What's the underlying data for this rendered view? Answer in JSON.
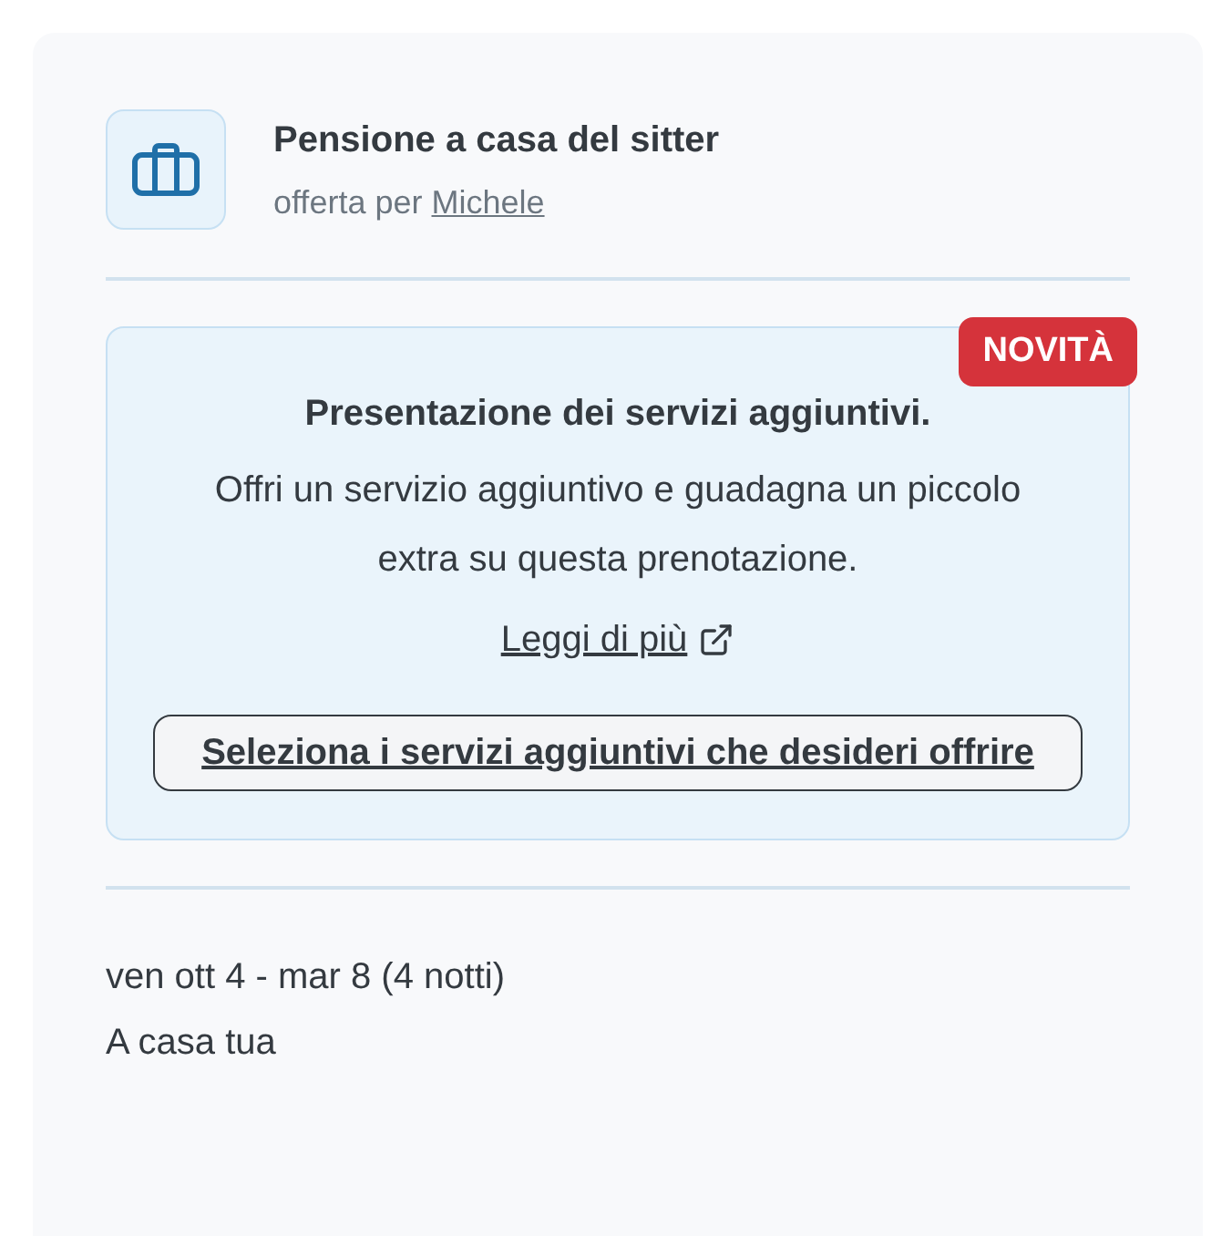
{
  "service": {
    "title": "Pensione a casa del sitter",
    "offered_by": "offerta per",
    "sitter_name": "Michele"
  },
  "promo": {
    "badge": "NOVITÀ",
    "heading": "Presentazione dei servizi aggiuntivi.",
    "body": "Offri un servizio aggiuntivo e guadagna un piccolo extra su questa prenotazione.",
    "link": "Leggi di più",
    "button": "Seleziona i servizi aggiuntivi che desideri offrire"
  },
  "booking": {
    "dates": "ven ott 4 - mar 8 (4 notti)",
    "location": "A casa tua"
  }
}
